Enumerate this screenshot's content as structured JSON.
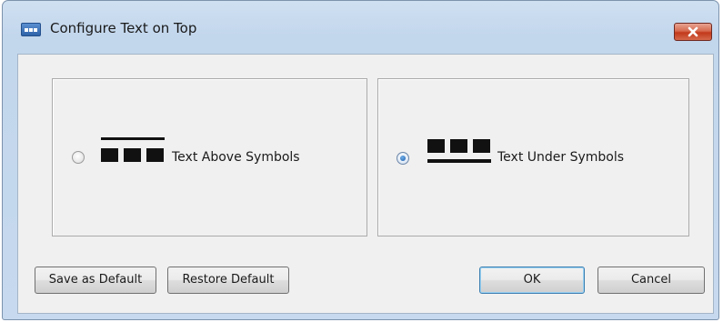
{
  "window": {
    "title": "Configure Text on Top",
    "icon": "app-window-icon",
    "close_icon": "close-icon"
  },
  "options": [
    {
      "label": "Text Above Symbols",
      "selected": false,
      "icon": "text-above-symbols-icon"
    },
    {
      "label": "Text Under Symbols",
      "selected": true,
      "icon": "text-under-symbols-icon"
    }
  ],
  "buttons": {
    "save_default": "Save as Default",
    "restore_default": "Restore Default",
    "ok": "OK",
    "cancel": "Cancel"
  },
  "colors": {
    "close_button": "#c2391b",
    "default_button_border": "#3c7fb1",
    "radio_dot": "#1d5ba8"
  }
}
